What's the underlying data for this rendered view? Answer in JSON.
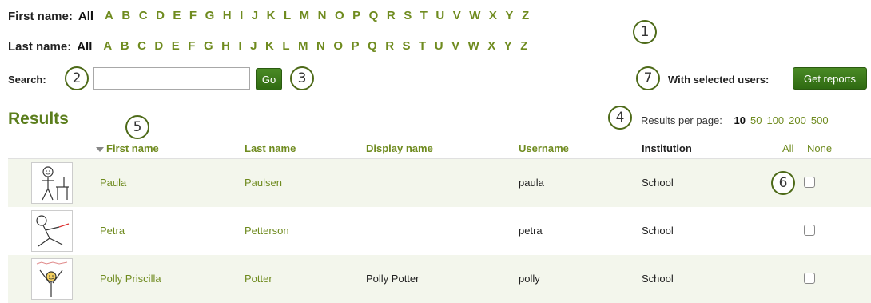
{
  "filters": {
    "first_name": {
      "label": "First name:",
      "all": "All",
      "letters": [
        "A",
        "B",
        "C",
        "D",
        "E",
        "F",
        "G",
        "H",
        "I",
        "J",
        "K",
        "L",
        "M",
        "N",
        "O",
        "P",
        "Q",
        "R",
        "S",
        "T",
        "U",
        "V",
        "W",
        "X",
        "Y",
        "Z"
      ]
    },
    "last_name": {
      "label": "Last name:",
      "all": "All",
      "letters": [
        "A",
        "B",
        "C",
        "D",
        "E",
        "F",
        "G",
        "H",
        "I",
        "J",
        "K",
        "L",
        "M",
        "N",
        "O",
        "P",
        "Q",
        "R",
        "S",
        "T",
        "U",
        "V",
        "W",
        "X",
        "Y",
        "Z"
      ]
    }
  },
  "search": {
    "label": "Search:",
    "value": "",
    "go_label": "Go"
  },
  "bulk": {
    "label": "With selected users:",
    "button_label": "Get reports"
  },
  "results": {
    "heading": "Results",
    "per_page_label": "Results per page:",
    "per_page_options": [
      "10",
      "50",
      "100",
      "200",
      "500"
    ],
    "per_page_selected": "10"
  },
  "table": {
    "columns": {
      "first_name": "First name",
      "last_name": "Last name",
      "display_name": "Display name",
      "username": "Username",
      "institution": "Institution"
    },
    "select_all": "All",
    "select_none": "None",
    "rows": [
      {
        "first_name": "Paula",
        "last_name": "Paulsen",
        "display_name": "",
        "username": "paula",
        "institution": "School",
        "avatar_icon": "stick-figure-desk-icon"
      },
      {
        "first_name": "Petra",
        "last_name": "Petterson",
        "display_name": "",
        "username": "petra",
        "institution": "School",
        "avatar_icon": "stick-figure-sitting-icon"
      },
      {
        "first_name": "Polly Priscilla",
        "last_name": "Potter",
        "display_name": "Polly Potter",
        "username": "polly",
        "institution": "School",
        "avatar_icon": "stick-figure-this-is-me-icon"
      }
    ]
  },
  "callouts": [
    "1",
    "2",
    "3",
    "4",
    "5",
    "6",
    "7"
  ],
  "colors": {
    "link": "#6f8b1f",
    "heading": "#5b7e1c",
    "button": "#3d7a1c",
    "row_stripe": "#f3f6ec",
    "callout_border": "#4d6a18"
  }
}
